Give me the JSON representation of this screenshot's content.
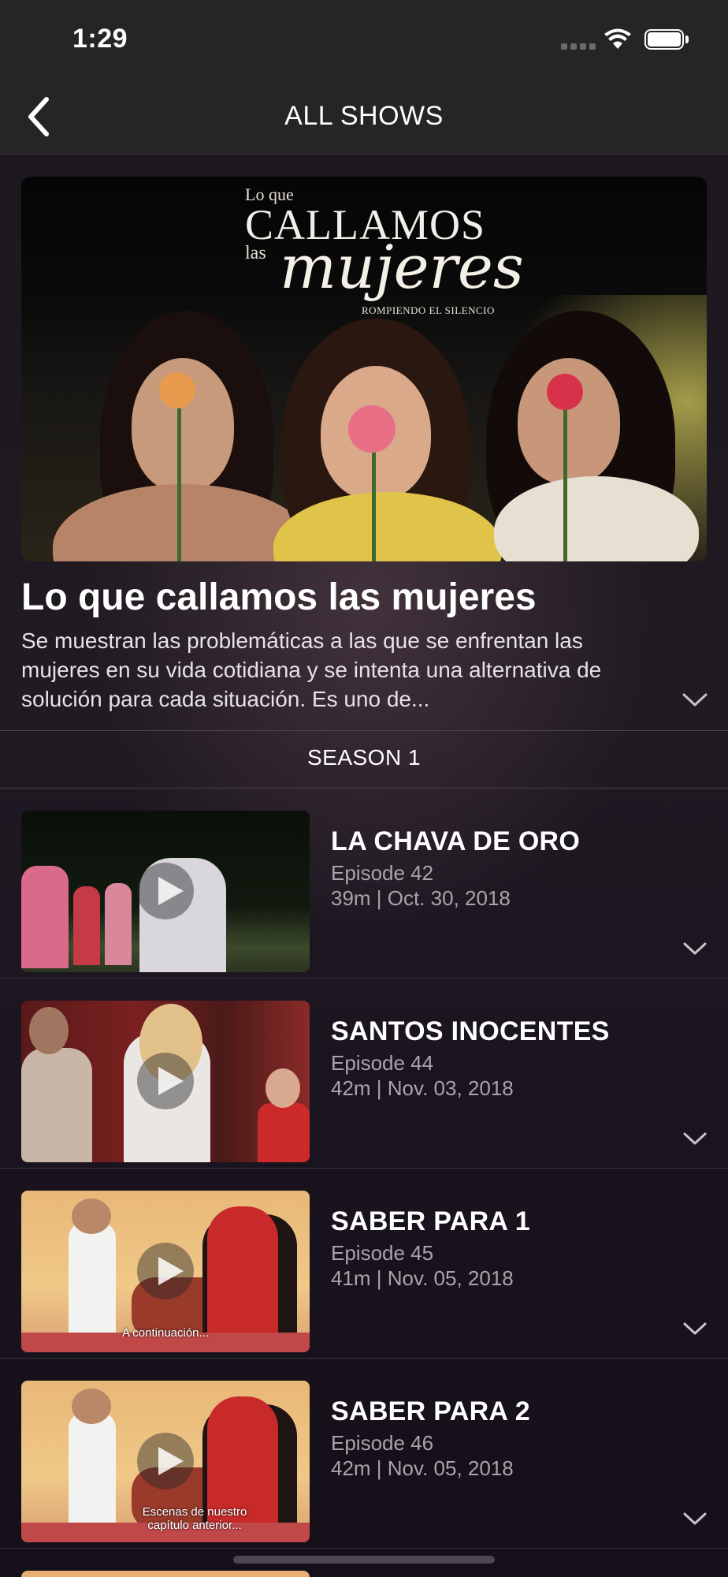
{
  "status_bar": {
    "time": "1:29"
  },
  "nav": {
    "title": "ALL SHOWS"
  },
  "show": {
    "poster": {
      "line1": "Lo que",
      "line2": "CALLAMOS",
      "line3": "las",
      "line4": "mujeres",
      "tagline": "ROMPIENDO EL SILENCIO"
    },
    "title": "Lo que callamos las mujeres",
    "description": "Se muestran las problemáticas a las que se enfrentan las mujeres en su vida cotidiana y se intenta una alternativa de solución para cada situación. Es uno de..."
  },
  "season": {
    "label": "SEASON 1"
  },
  "episodes": [
    {
      "title": "LA CHAVA DE ORO",
      "number": "Episode 42",
      "meta": "39m | Oct. 30, 2018",
      "caption": ""
    },
    {
      "title": "SANTOS INOCENTES",
      "number": "Episode 44",
      "meta": "42m | Nov. 03, 2018",
      "caption": ""
    },
    {
      "title": "SABER PARA 1",
      "number": "Episode 45",
      "meta": "41m | Nov. 05, 2018",
      "caption": "A continuación..."
    },
    {
      "title": "SABER PARA 2",
      "number": "Episode 46",
      "meta": "42m | Nov. 05, 2018",
      "caption": "Escenas de nuestro capítulo anterior..."
    }
  ],
  "icons": {
    "back": "chevron-left-icon",
    "expand": "chevron-down-icon",
    "play": "play-icon",
    "wifi": "wifi-icon",
    "battery": "battery-icon",
    "signal": "signal-icon"
  }
}
